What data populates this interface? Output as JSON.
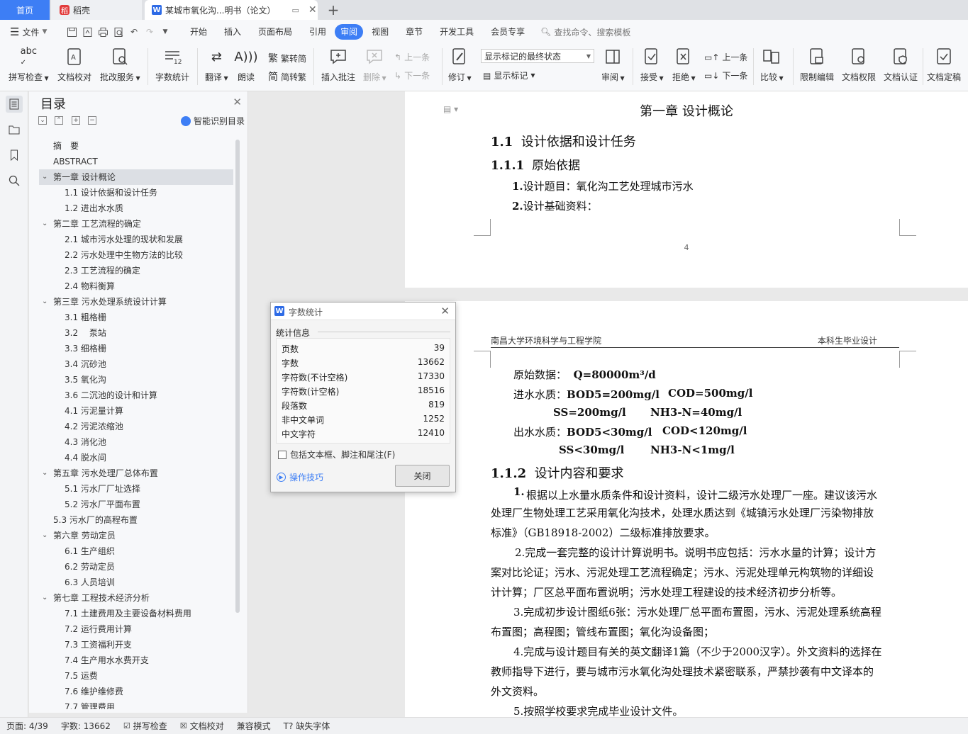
{
  "tabs": {
    "home": "首页",
    "daoke": "稻壳",
    "document": "某城市氧化沟...明书（论文）"
  },
  "menubar": {
    "file": "文件",
    "items": [
      "开始",
      "插入",
      "页面布局",
      "引用",
      "审阅",
      "视图",
      "章节",
      "开发工具",
      "会员专享"
    ],
    "active": "审阅",
    "search_placeholder": "查找命令、搜索模板"
  },
  "ribbon": {
    "spell_check": "拼写检查",
    "doc_check": "文档校对",
    "batch_service": "批改服务",
    "word_count": "字数统计",
    "translate": "翻译",
    "read_aloud": "朗读",
    "to_traditional": "繁转简",
    "to_simplified": "简转繁",
    "insert_comment": "插入批注",
    "delete": "删除",
    "prev_comment": "上一条",
    "next_comment": "下一条",
    "track_changes": "修订",
    "markup_state": "显示标记的最终状态",
    "show_markup": "显示标记",
    "review_pane": "审阅",
    "accept": "接受",
    "reject": "拒绝",
    "prev_change": "上一条",
    "next_change": "下一条",
    "compare": "比较",
    "restrict_edit": "限制编辑",
    "doc_permission": "文档权限",
    "doc_auth": "文档认证",
    "doc_finalize": "文档定稿"
  },
  "toc": {
    "title": "目录",
    "smart_label": "智能识别目录",
    "items": [
      {
        "label": "摘　要",
        "level": 0,
        "caret": false
      },
      {
        "label": "ABSTRACT",
        "level": 0,
        "caret": false
      },
      {
        "label": "第一章 设计概论",
        "level": 0,
        "caret": true,
        "selected": true
      },
      {
        "label": "1.1 设计依据和设计任务",
        "level": 1
      },
      {
        "label": "1.2 进出水水质",
        "level": 1
      },
      {
        "label": "第二章 工艺流程的确定",
        "level": 0,
        "caret": true
      },
      {
        "label": "2.1 城市污水处理的现状和发展",
        "level": 1
      },
      {
        "label": "2.2 污水处理中生物方法的比较",
        "level": 1
      },
      {
        "label": "2.3 工艺流程的确定",
        "level": 1
      },
      {
        "label": "2.4 物料衡算",
        "level": 1
      },
      {
        "label": "第三章 污水处理系统设计计算",
        "level": 0,
        "caret": true
      },
      {
        "label": "3.1 粗格栅",
        "level": 1
      },
      {
        "label": "3.2 　泵站",
        "level": 1
      },
      {
        "label": "3.3 细格栅",
        "level": 1
      },
      {
        "label": "3.4 沉砂池",
        "level": 1
      },
      {
        "label": "3.5 氧化沟",
        "level": 1
      },
      {
        "label": "3.6 二沉池的设计和计算",
        "level": 1
      },
      {
        "label": "4.1 污泥量计算",
        "level": 1
      },
      {
        "label": "4.2 污泥浓缩池",
        "level": 1
      },
      {
        "label": "4.3 消化池",
        "level": 1
      },
      {
        "label": "4.4 脱水间",
        "level": 1
      },
      {
        "label": "第五章 污水处理厂总体布置",
        "level": 0,
        "caret": true
      },
      {
        "label": "5.1 污水厂厂址选择",
        "level": 1
      },
      {
        "label": "5.2 污水厂平面布置",
        "level": 1
      },
      {
        "label": "5.3 污水厂的高程布置",
        "level": 0,
        "caret": false
      },
      {
        "label": "第六章 劳动定员",
        "level": 0,
        "caret": true
      },
      {
        "label": "6.1 生产组织",
        "level": 1
      },
      {
        "label": "6.2 劳动定员",
        "level": 1
      },
      {
        "label": "6.3 人员培训",
        "level": 1
      },
      {
        "label": "第七章 工程技术经济分析",
        "level": 0,
        "caret": true
      },
      {
        "label": "7.1 土建费用及主要设备材料费用",
        "level": 1
      },
      {
        "label": "7.2 运行费用计算",
        "level": 1
      },
      {
        "label": "7.3 工资福利开支",
        "level": 1
      },
      {
        "label": "7.4 生产用水水费开支",
        "level": 1
      },
      {
        "label": "7.5 运费",
        "level": 1
      },
      {
        "label": "7.6 维护维修费",
        "level": 1
      },
      {
        "label": "7.7 管理费用",
        "level": 1
      }
    ]
  },
  "page1": {
    "chapter": "第一章  设计概论",
    "h11_num": "1.1",
    "h11_text": "设计依据和设计任务",
    "h111_num": "1.1.1",
    "h111_text": "原始依据",
    "item1_num": "1.",
    "item1_text": "设计题目：氧化沟工艺处理城市污水",
    "item2_num": "2.",
    "item2_text": "设计基础资料：",
    "page_number": "4"
  },
  "page2": {
    "header_left": "南昌大学环境科学与工程学院",
    "header_right": "本科生毕业设计",
    "raw_label": "原始数据：",
    "raw_value": "Q=80000m³/d",
    "in_label": "进水水质：",
    "in_bod": "BOD5=200mg/l",
    "in_cod": "COD=500mg/l",
    "in_ss": "SS=200mg/l",
    "in_nh3": "NH3-N=40mg/l",
    "out_label": "出水水质：",
    "out_bod": "BOD5<30mg/l",
    "out_cod": "COD<120mg/l",
    "out_ss": "SS<30mg/l",
    "out_nh3": "NH3-N<1mg/l",
    "h112_num": "1.1.2",
    "h112_text": "设计内容和要求",
    "p1_lines": [
      "根据以上水量水质条件和设计资料，设计二级污水处理厂一座。建议该污水",
      "处理厂生物处理工艺采用氧化沟技术，处理水质达到《城镇污水处理厂污染物排放",
      "标准》（GB18918-2002）二级标准排放要求。"
    ],
    "p2_lines": [
      "2.完成一套完整的设计计算说明书。说明书应包括：污水水量的计算；设计方",
      "案对比论证；污水、污泥处理工艺流程确定；污水、污泥处理单元构筑物的详细设",
      "计计算；厂区总平面布置说明；污水处理工程建设的技术经济初步分析等。"
    ],
    "p3_lines": [
      "3.完成初步设计图纸6张：污水处理厂总平面布置图，污水、污泥处理系统高程",
      "布置图；高程图；管线布置图；氧化沟设备图；"
    ],
    "p4_lines": [
      "4.完成与设计题目有关的英文翻译1篇（不少于2000汉字）。外文资料的选择在",
      "教师指导下进行，要与城市污水氧化沟处理技术紧密联系，严禁抄袭有中文译本的",
      "外文资料。"
    ],
    "p5_line": "5.按照学校要求完成毕业设计文件。"
  },
  "dialog": {
    "title": "字数统计",
    "section": "统计信息",
    "rows": [
      {
        "label": "页数",
        "value": "39"
      },
      {
        "label": "字数",
        "value": "13662"
      },
      {
        "label": "字符数(不计空格)",
        "value": "17330"
      },
      {
        "label": "字符数(计空格)",
        "value": "18516"
      },
      {
        "label": "段落数",
        "value": "819"
      },
      {
        "label": "非中文单词",
        "value": "1252"
      },
      {
        "label": "中文字符",
        "value": "12410"
      }
    ],
    "checkbox_label": "包括文本框、脚注和尾注(F)",
    "tips_link": "操作技巧",
    "close_button": "关闭"
  },
  "statusbar": {
    "page": "页面: 4/39",
    "words": "字数: 13662",
    "spell": "拼写检查",
    "doccheck": "文档校对",
    "compat": "兼容模式",
    "missing_font": "缺失字体"
  },
  "colors": {
    "accent": "#3d7ef5",
    "tab_home": "#3d7ef5",
    "daoke_red": "#e23b3b"
  }
}
